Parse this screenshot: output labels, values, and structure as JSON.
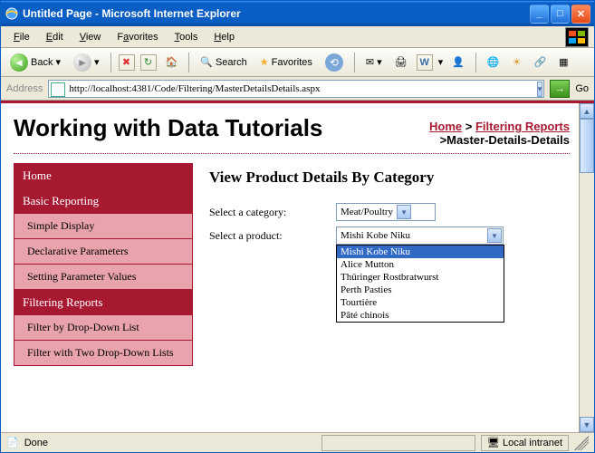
{
  "window": {
    "title": "Untitled Page - Microsoft Internet Explorer"
  },
  "menus": [
    "File",
    "Edit",
    "View",
    "Favorites",
    "Tools",
    "Help"
  ],
  "toolbar": {
    "back": "Back",
    "search": "Search",
    "favorites": "Favorites"
  },
  "addressbar": {
    "label": "Address",
    "url": "http://localhost:4381/Code/Filtering/MasterDetailsDetails.aspx",
    "go": "Go"
  },
  "page": {
    "h1": "Working with Data Tutorials",
    "breadcrumb": {
      "home": "Home",
      "sep": " > ",
      "section": "Filtering Reports",
      "current": "Master-Details-Details"
    },
    "sidebar": [
      {
        "type": "hdr",
        "label": "Home"
      },
      {
        "type": "hdr",
        "label": "Basic Reporting"
      },
      {
        "type": "sub",
        "label": "Simple Display"
      },
      {
        "type": "sub",
        "label": "Declarative Parameters"
      },
      {
        "type": "sub",
        "label": "Setting Parameter Values"
      },
      {
        "type": "hdr",
        "label": "Filtering Reports"
      },
      {
        "type": "sub",
        "label": "Filter by Drop-Down List"
      },
      {
        "type": "sub",
        "label": "Filter with Two Drop-Down Lists"
      }
    ],
    "main": {
      "heading": "View Product Details By Category",
      "row_category_label": "Select a category:",
      "row_product_label": "Select a product:",
      "category_selected": "Meat/Poultry",
      "product_selected": "Mishi Kobe Niku",
      "product_options": [
        "Mishi Kobe Niku",
        "Alice Mutton",
        "Thüringer Rostbratwurst",
        "Perth Pasties",
        "Tourtière",
        "Pâté chinois"
      ]
    }
  },
  "status": {
    "done": "Done",
    "zone": "Local intranet"
  }
}
